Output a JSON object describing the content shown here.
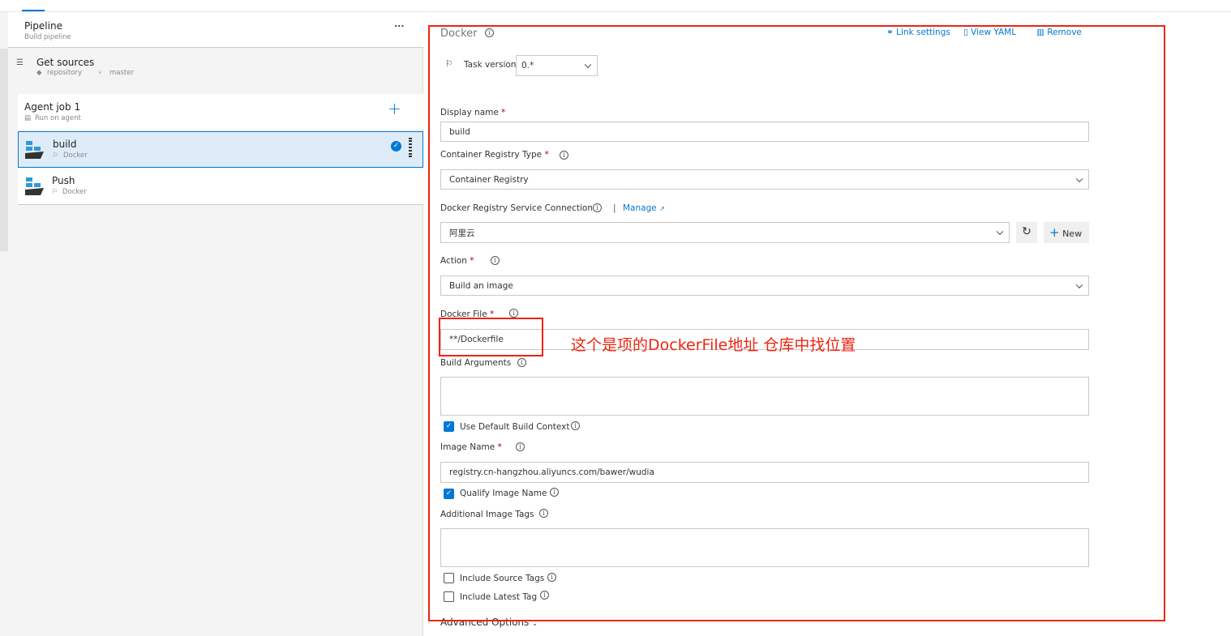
{
  "left": {
    "pipeline": {
      "title": "Pipeline",
      "subtitle": "Build pipeline",
      "more": "..."
    },
    "get_sources": {
      "title": "Get sources",
      "repo": "repository",
      "branch": "master"
    },
    "agent_job": {
      "title": "Agent job 1",
      "subtitle": "Run on agent",
      "add": "+"
    },
    "tasks": [
      {
        "name": "build",
        "type": "Docker",
        "selected": true
      },
      {
        "name": "Push",
        "type": "Docker",
        "selected": false
      }
    ]
  },
  "panel": {
    "title": "Docker",
    "actions": {
      "link_settings": "Link settings",
      "view_yaml": "View YAML",
      "remove": "Remove"
    },
    "task_version_label": "Task version",
    "task_version": "0.*",
    "display_name_label": "Display name",
    "display_name": "build",
    "registry_type_label": "Container Registry Type",
    "registry_type": "Container Registry",
    "service_conn_label": "Docker Registry Service Connection",
    "manage": "Manage",
    "service_conn": "阿里云",
    "new": "New",
    "action_label": "Action",
    "action": "Build an image",
    "docker_file_label": "Docker File",
    "docker_file": "**/Dockerfile",
    "build_args_label": "Build Arguments",
    "build_args": "",
    "use_default_ctx": "Use Default Build Context",
    "use_default_ctx_checked": true,
    "image_name_label": "Image Name",
    "image_name": "registry.cn-hangzhou.aliyuncs.com/bawer/wudia",
    "qualify": "Qualify Image Name",
    "qualify_checked": true,
    "tags_label": "Additional Image Tags",
    "tags": "",
    "source_tags": "Include Source Tags",
    "source_tags_checked": false,
    "latest_tag": "Include Latest Tag",
    "latest_tag_checked": false,
    "advanced": "Advanced Options",
    "required_mark": "*"
  },
  "annotation": {
    "text": "这个是项的DockerFile地址 仓库中找位置",
    "color": "#f0230f"
  }
}
